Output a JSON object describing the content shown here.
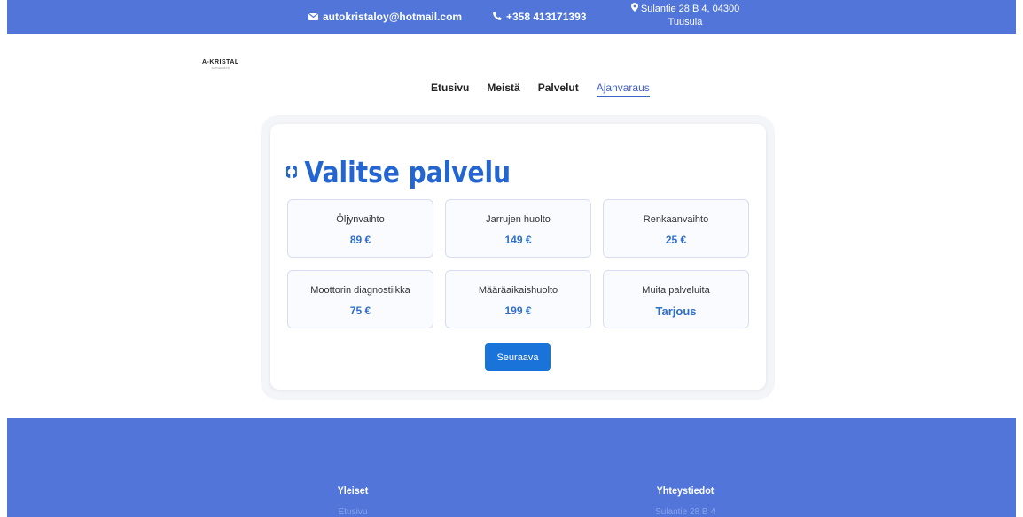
{
  "topbar": {
    "email": "autokristaloy@hotmail.com",
    "phone": "+358 413171393",
    "address_line1": "Sulantie 28 B 4, 04300",
    "address_line2": "Tuusula"
  },
  "logo": {
    "name": "A-KRISTAL",
    "tagline": "AUTOHUOLTO"
  },
  "nav": [
    "Etusivu",
    "Meistä",
    "Palvelut",
    "Ajanvaraus"
  ],
  "page": {
    "title": "Valitse palvelu",
    "next_button": "Seuraava"
  },
  "services": [
    {
      "name": "Öljynvaihto",
      "price": "89 €"
    },
    {
      "name": "Jarrujen huolto",
      "price": "149 €"
    },
    {
      "name": "Renkaanvaihto",
      "price": "25 €"
    },
    {
      "name": "Moottorin diagnostiikka",
      "price": "75 €"
    },
    {
      "name": "Määräaikaishuolto",
      "price": "199 €"
    },
    {
      "name": "Muita palveluita",
      "price": "Tarjous"
    }
  ],
  "footer": {
    "col1_heading": "Yleiset",
    "col1_link": "Etusivu",
    "col2_heading": "Yhteystiedot",
    "col2_link": "Sulantie 28 B 4"
  },
  "colors": {
    "accent": "#5175d9",
    "primary": "#2366d1"
  },
  "icons": [
    "mail-icon",
    "phone-icon",
    "map-pin-icon"
  ]
}
